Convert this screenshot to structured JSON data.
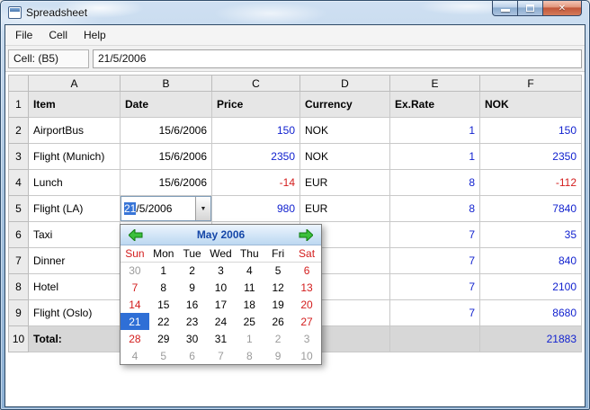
{
  "window": {
    "title": "Spreadsheet"
  },
  "icons": {
    "close": "✕",
    "dropdown": "▼"
  },
  "menu": {
    "items": [
      "File",
      "Cell",
      "Help"
    ]
  },
  "toolbar": {
    "cell_ref": "Cell: (B5)",
    "cell_value": "21/5/2006"
  },
  "spreadsheet": {
    "column_headers": [
      "A",
      "B",
      "C",
      "D",
      "E",
      "F"
    ],
    "rows": [
      {
        "num": "1",
        "header": true,
        "item": "Item",
        "date": "Date",
        "price": "Price",
        "priceColor": "",
        "currency": "Currency",
        "exrate": "Ex.Rate",
        "rateColor": "",
        "nok": "NOK",
        "nokColor": ""
      },
      {
        "num": "2",
        "item": "AirportBus",
        "date": "15/6/2006",
        "price": "150",
        "priceColor": "pos",
        "currency": "NOK",
        "exrate": "1",
        "rateColor": "pos",
        "nok": "150",
        "nokColor": "pos"
      },
      {
        "num": "3",
        "item": "Flight (Munich)",
        "date": "15/6/2006",
        "price": "2350",
        "priceColor": "pos",
        "currency": "NOK",
        "exrate": "1",
        "rateColor": "pos",
        "nok": "2350",
        "nokColor": "pos"
      },
      {
        "num": "4",
        "item": "Lunch",
        "date": "15/6/2006",
        "price": "-14",
        "priceColor": "neg",
        "currency": "EUR",
        "exrate": "8",
        "rateColor": "pos",
        "nok": "-112",
        "nokColor": "neg"
      },
      {
        "num": "5",
        "item": "Flight (LA)",
        "editor": true,
        "date": "21/5/2006",
        "price": "980",
        "priceColor": "pos",
        "currency": "EUR",
        "exrate": "8",
        "rateColor": "pos",
        "nok": "7840",
        "nokColor": "pos"
      },
      {
        "num": "6",
        "item": "Taxi",
        "date": "",
        "price": "",
        "priceColor": "",
        "currency": "",
        "exrate": "7",
        "rateColor": "pos",
        "nok": "35",
        "nokColor": "pos"
      },
      {
        "num": "7",
        "item": "Dinner",
        "date": "",
        "price": "",
        "priceColor": "",
        "currency": "",
        "exrate": "7",
        "rateColor": "pos",
        "nok": "840",
        "nokColor": "pos"
      },
      {
        "num": "8",
        "item": "Hotel",
        "date": "",
        "price": "",
        "priceColor": "",
        "currency": "",
        "exrate": "7",
        "rateColor": "pos",
        "nok": "2100",
        "nokColor": "pos"
      },
      {
        "num": "9",
        "item": "Flight (Oslo)",
        "date": "",
        "price": "",
        "priceColor": "",
        "currency": "",
        "exrate": "7",
        "rateColor": "pos",
        "nok": "8680",
        "nokColor": "pos"
      },
      {
        "num": "10",
        "total": true,
        "item": "Total:",
        "date": "",
        "price": "",
        "priceColor": "",
        "currency": "",
        "exrate": "",
        "rateColor": "",
        "nok": "21883",
        "nokColor": "pos"
      }
    ]
  },
  "date_editor": {
    "selected_text": "21",
    "rest_text": "/5/2006"
  },
  "calendar": {
    "month_label": "May  2006",
    "weekdays": [
      {
        "label": "Sun",
        "weekend": true
      },
      {
        "label": "Mon"
      },
      {
        "label": "Tue"
      },
      {
        "label": "Wed"
      },
      {
        "label": "Thu"
      },
      {
        "label": "Fri"
      },
      {
        "label": "Sat",
        "weekend": true
      }
    ],
    "weeks": [
      [
        {
          "d": "30",
          "muted": true
        },
        {
          "d": "1"
        },
        {
          "d": "2"
        },
        {
          "d": "3"
        },
        {
          "d": "4"
        },
        {
          "d": "5"
        },
        {
          "d": "6",
          "weekend": true
        }
      ],
      [
        {
          "d": "7",
          "weekend": true
        },
        {
          "d": "8"
        },
        {
          "d": "9"
        },
        {
          "d": "10"
        },
        {
          "d": "11"
        },
        {
          "d": "12"
        },
        {
          "d": "13",
          "weekend": true
        }
      ],
      [
        {
          "d": "14",
          "weekend": true
        },
        {
          "d": "15"
        },
        {
          "d": "16"
        },
        {
          "d": "17"
        },
        {
          "d": "18"
        },
        {
          "d": "19"
        },
        {
          "d": "20",
          "weekend": true
        }
      ],
      [
        {
          "d": "21",
          "selected": true
        },
        {
          "d": "22"
        },
        {
          "d": "23"
        },
        {
          "d": "24"
        },
        {
          "d": "25"
        },
        {
          "d": "26"
        },
        {
          "d": "27",
          "weekend": true
        }
      ],
      [
        {
          "d": "28",
          "weekend": true
        },
        {
          "d": "29"
        },
        {
          "d": "30"
        },
        {
          "d": "31"
        },
        {
          "d": "1",
          "muted": true
        },
        {
          "d": "2",
          "muted": true
        },
        {
          "d": "3",
          "muted": true
        }
      ],
      [
        {
          "d": "4",
          "muted": true
        },
        {
          "d": "5",
          "muted": true
        },
        {
          "d": "6",
          "muted": true
        },
        {
          "d": "7",
          "muted": true
        },
        {
          "d": "8",
          "muted": true
        },
        {
          "d": "9",
          "muted": true
        },
        {
          "d": "10",
          "muted": true
        }
      ]
    ]
  },
  "colors": {
    "positive_number": "#1222cf",
    "negative_number": "#d31d1d",
    "selected_day_bg": "#2f6fd6",
    "frame_blue": "#a9c5e1"
  }
}
